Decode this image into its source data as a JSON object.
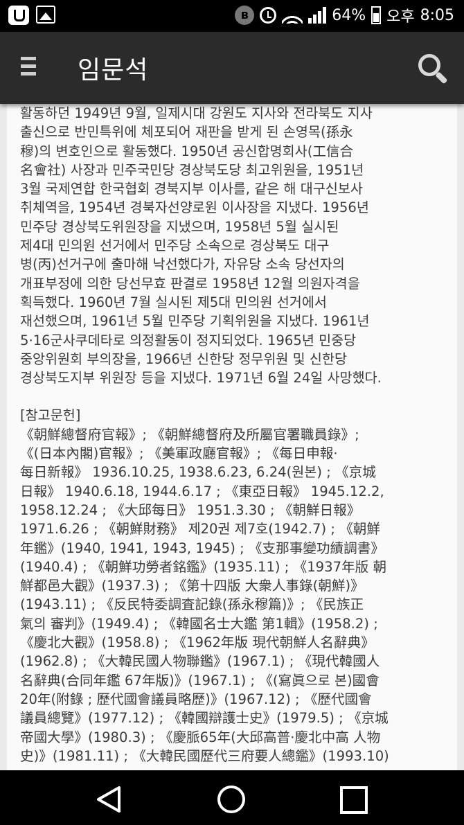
{
  "status_bar": {
    "battery_percent": "64%",
    "period": "오후",
    "time": "8:05",
    "icons": [
      "app-icon",
      "gallery-icon",
      "bluetooth-icon",
      "alarm-icon",
      "wifi-icon",
      "signal-icon",
      "battery-icon"
    ]
  },
  "app_bar": {
    "title": "임문석",
    "menu_icon": "hamburger-menu-icon",
    "search_icon": "search-icon"
  },
  "article": {
    "body_lines": [
      "활동하던 1949년 9월, 일제시대 강원도 지사와 전라북도 지사",
      "출신으로 반민특위에 체포되어 재판을 받게 된 손영목(孫永",
      "穆)의 변호인으로 활동했다. 1950년 공신합명회사(工信合",
      "名會社) 사장과 민주국민당 경상북도당 최고위원을, 1951년",
      "3월 국제연합 한국협회 경북지부 이사를, 같은 해 대구신보사",
      "취체역을, 1954년 경북자선양로원 이사장을 지냈다. 1956년",
      "민주당 경상북도위원장을 지냈으며, 1958년 5월 실시된",
      "제4대 민의원 선거에서 민주당 소속으로 경상북도 대구",
      "병(丙)선거구에 출마해 낙선했다가, 자유당 소속 당선자의",
      "개표부정에 의한 당선무효 판결로 1958년 12월 의원자격을",
      "획득했다. 1960년 7월 실시된 제5대 민의원 선거에서",
      "재선했으며, 1961년 5월 민주당 기획위원을 지냈다. 1961년",
      "5·16군사쿠데타로 의정활동이 정지되었다. 1965년 민중당",
      "중앙위원회 부의장을, 1966년 신한당 정무위원 및 신한당",
      "경상북도지부 위원장 등을 지냈다. 1971년 6월 24일 사망했다."
    ],
    "references_header": "[참고문헌]",
    "reference_lines": [
      "《朝鮮總督府官報》; 《朝鮮總督府及所屬官署職員錄》;",
      "《(日本內閣)官報》; 《美軍政廳官報》; 《每日申報·",
      "每日新報》 1936.10.25, 1938.6.23, 6.24(원본) ; 《京城",
      "日報》 1940.6.18, 1944.6.17 ; 《東亞日報》 1945.12.2,",
      "1958.12.24 ; 《大邱每日》 1951.3.30 ; 《朝鮮日報》",
      "1971.6.26 ; 《朝鮮財務》 제20권 제7호(1942.7) ; 《朝鮮",
      "年鑑》(1940, 1941, 1943, 1945) ; 《支那事變功績調書》",
      "(1940.4) ; 《朝鮮功勞者銘鑑》(1935.11) ; 《1937年版 朝",
      "鮮都邑大觀》(1937.3) ; 《第十四版 大衆人事錄(朝鮮)》",
      "(1943.11) ; 《反民特委調査記錄(孫永穆篇)》; 《民族正",
      "氣의 審判》(1949.4) ; 《韓國名士大鑑 第1輯》(1958.2) ;",
      "《慶北大觀》(1958.8) ; 《1962年版 現代朝鮮人名辭典》",
      "(1962.8) ; 《大韓民國人物聯鑑》(1967.1) ; 《現代韓國人",
      "名辭典(合同年鑑 67年版)》(1967.1) ; 《(寫眞으로 본)國會",
      "20年(附錄 ; 歷代國會議員略歷)》(1967.12) ; 《歷代國會",
      "議員總覽》(1977.12) ; 《韓國辯護士史》(1979.5) ; 《京城",
      "帝國大學》(1980.3) ; 《慶脈65年(大邱高普·慶北中高 人物",
      "史)》(1981.11) ; 《大韓民國歷代三府要人總鑑》(1993.10)"
    ]
  },
  "nav_bar": {
    "back_icon": "back-triangle-icon",
    "home_icon": "home-circle-icon",
    "recent_icon": "recent-apps-square-icon"
  }
}
